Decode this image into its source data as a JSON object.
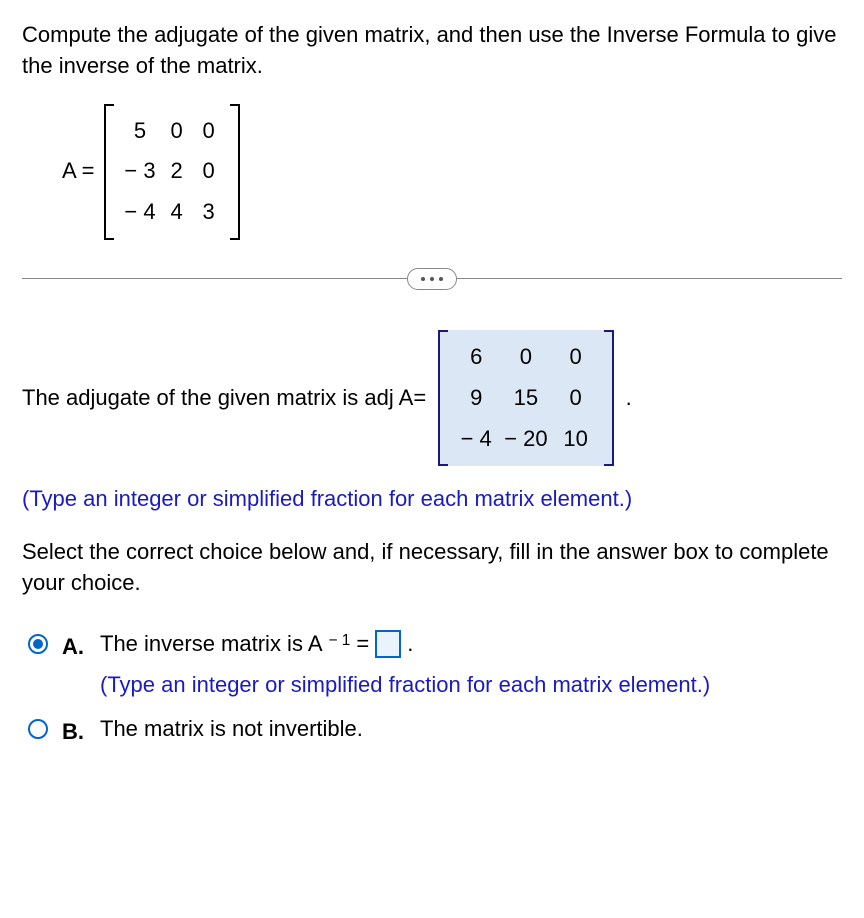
{
  "prompt": "Compute the adjugate of the given matrix, and then use the Inverse Formula to give the inverse of the matrix.",
  "matrixA": {
    "label": "A =",
    "cells": [
      "5",
      "0",
      "0",
      "− 3",
      "2",
      "0",
      "− 4",
      "4",
      "3"
    ]
  },
  "adjugate": {
    "lead": "The adjugate of the given matrix is adj A=",
    "cells": [
      "6",
      "0",
      "0",
      "9",
      "15",
      "0",
      "− 4",
      "− 20",
      "10"
    ],
    "trail": "."
  },
  "hint": "(Type an integer or simplified fraction for each matrix element.)",
  "select": "Select the correct choice below and, if necessary, fill in the answer box to complete your choice.",
  "choices": {
    "A": {
      "label": "A.",
      "text1": "The inverse matrix is A",
      "sup": "− 1",
      "text2": " = ",
      "trail": ".",
      "hint": "(Type an integer or simplified fraction for each matrix element.)"
    },
    "B": {
      "label": "B.",
      "text": "The matrix is not invertible."
    }
  }
}
